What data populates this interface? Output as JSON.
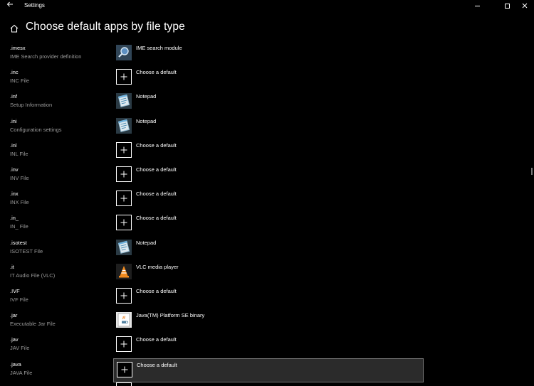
{
  "window": {
    "title": "Settings"
  },
  "page": {
    "title": "Choose default apps by file type"
  },
  "rows": [
    {
      "ext": ".imesx",
      "desc": "IME Search provider definition",
      "app": "IME search module",
      "icon": "search-module-icon"
    },
    {
      "ext": ".inc",
      "desc": "INC File",
      "app": "Choose a default",
      "icon": "plus-icon"
    },
    {
      "ext": ".inf",
      "desc": "Setup Information",
      "app": "Notepad",
      "icon": "notepad-icon"
    },
    {
      "ext": ".ini",
      "desc": "Configuration settings",
      "app": "Notepad",
      "icon": "notepad-icon"
    },
    {
      "ext": ".inl",
      "desc": "INL File",
      "app": "Choose a default",
      "icon": "plus-icon"
    },
    {
      "ext": ".inv",
      "desc": "INV File",
      "app": "Choose a default",
      "icon": "plus-icon"
    },
    {
      "ext": ".inx",
      "desc": "INX File",
      "app": "Choose a default",
      "icon": "plus-icon"
    },
    {
      "ext": ".in_",
      "desc": "IN_ File",
      "app": "Choose a default",
      "icon": "plus-icon"
    },
    {
      "ext": ".isotest",
      "desc": "ISOTEST File",
      "app": "Notepad",
      "icon": "notepad-icon"
    },
    {
      "ext": ".it",
      "desc": "IT Audio File (VLC)",
      "app": "VLC media player",
      "icon": "vlc-icon"
    },
    {
      "ext": ".IVF",
      "desc": "IVF File",
      "app": "Choose a default",
      "icon": "plus-icon"
    },
    {
      "ext": ".jar",
      "desc": "Executable Jar File",
      "app": "Java(TM) Platform SE binary",
      "icon": "java-icon"
    },
    {
      "ext": ".jav",
      "desc": "JAV File",
      "app": "Choose a default",
      "icon": "plus-icon"
    },
    {
      "ext": ".java",
      "desc": "JAVA File",
      "app": "Choose a default",
      "icon": "plus-icon",
      "selected": true
    }
  ],
  "colors": {
    "background": "#000000",
    "secondary_text": "#9a9a9a",
    "selected_background": "#2b2b2b",
    "selected_border": "#767676"
  }
}
